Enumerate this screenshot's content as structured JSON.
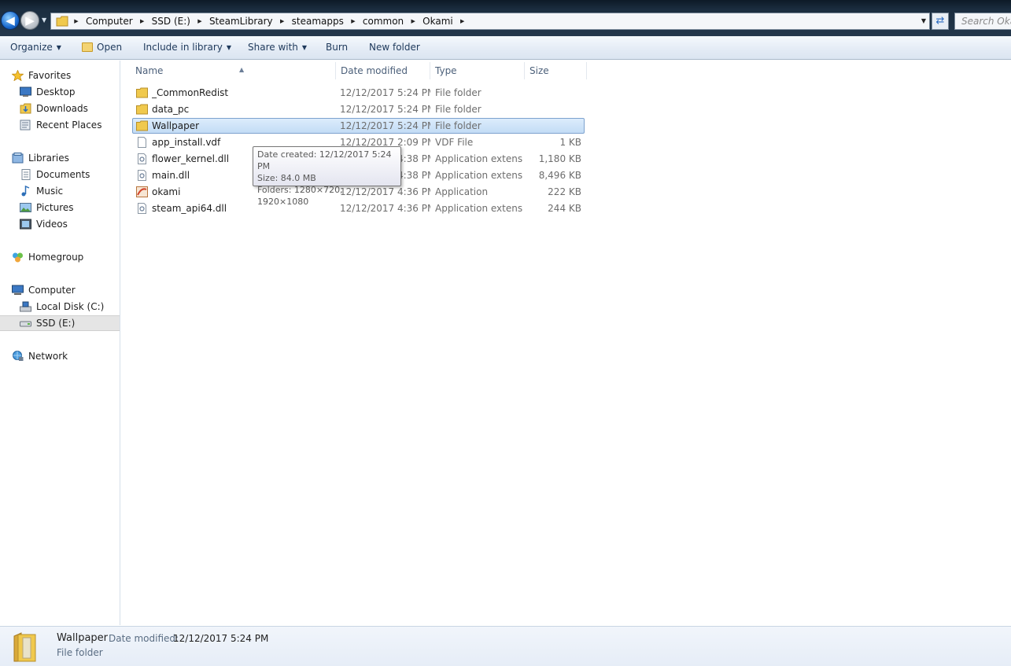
{
  "address_bar": {
    "crumbs": [
      "Computer",
      "SSD (E:)",
      "SteamLibrary",
      "steamapps",
      "common",
      "Okami"
    ],
    "search_placeholder": "Search Okami"
  },
  "toolbar": {
    "organize": "Organize",
    "open": "Open",
    "include_in_library": "Include in library",
    "share_with": "Share with",
    "burn": "Burn",
    "new_folder": "New folder"
  },
  "nav": {
    "favorites": "Favorites",
    "desktop": "Desktop",
    "downloads": "Downloads",
    "recent_places": "Recent Places",
    "libraries": "Libraries",
    "documents": "Documents",
    "music": "Music",
    "pictures": "Pictures",
    "videos": "Videos",
    "homegroup": "Homegroup",
    "computer": "Computer",
    "local_disk": "Local Disk (C:)",
    "ssd": "SSD (E:)",
    "network": "Network"
  },
  "columns": {
    "name": "Name",
    "date_modified": "Date modified",
    "type": "Type",
    "size": "Size"
  },
  "files": [
    {
      "name": "_CommonRedist",
      "date": "12/12/2017 5:24 PM",
      "type": "File folder",
      "size": "",
      "icon": "folder-icon"
    },
    {
      "name": "data_pc",
      "date": "12/12/2017 5:24 PM",
      "type": "File folder",
      "size": "",
      "icon": "folder-icon"
    },
    {
      "name": "Wallpaper",
      "date": "12/12/2017 5:24 PM",
      "type": "File folder",
      "size": "",
      "icon": "folder-icon",
      "selected": true
    },
    {
      "name": "app_install.vdf",
      "date": "12/12/2017 2:09 PM",
      "type": "VDF File",
      "size": "1 KB",
      "icon": "file-icon"
    },
    {
      "name": "flower_kernel.dll",
      "date": "12/12/2017 4:38 PM",
      "type": "Application extens...",
      "size": "1,180 KB",
      "icon": "dll-icon"
    },
    {
      "name": "main.dll",
      "date": "12/12/2017 4:38 PM",
      "type": "Application extens...",
      "size": "8,496 KB",
      "icon": "dll-icon"
    },
    {
      "name": "okami",
      "date": "12/12/2017 4:36 PM",
      "type": "Application",
      "size": "222 KB",
      "icon": "app-icon"
    },
    {
      "name": "steam_api64.dll",
      "date": "12/12/2017 4:36 PM",
      "type": "Application extens...",
      "size": "244 KB",
      "icon": "dll-icon"
    }
  ],
  "tooltip": {
    "date_created": "Date created: 12/12/2017 5:24 PM",
    "size": "Size: 84.0 MB",
    "folders": "Folders: 1280×720, 1920×1080"
  },
  "details": {
    "name": "Wallpaper",
    "date_label": "Date modified:",
    "date_value": "12/12/2017 5:24 PM",
    "type": "File folder"
  },
  "colors": {
    "selection": "#cce4f7",
    "titlebar": "#1b2d3f",
    "folder": "#f0c94d"
  }
}
